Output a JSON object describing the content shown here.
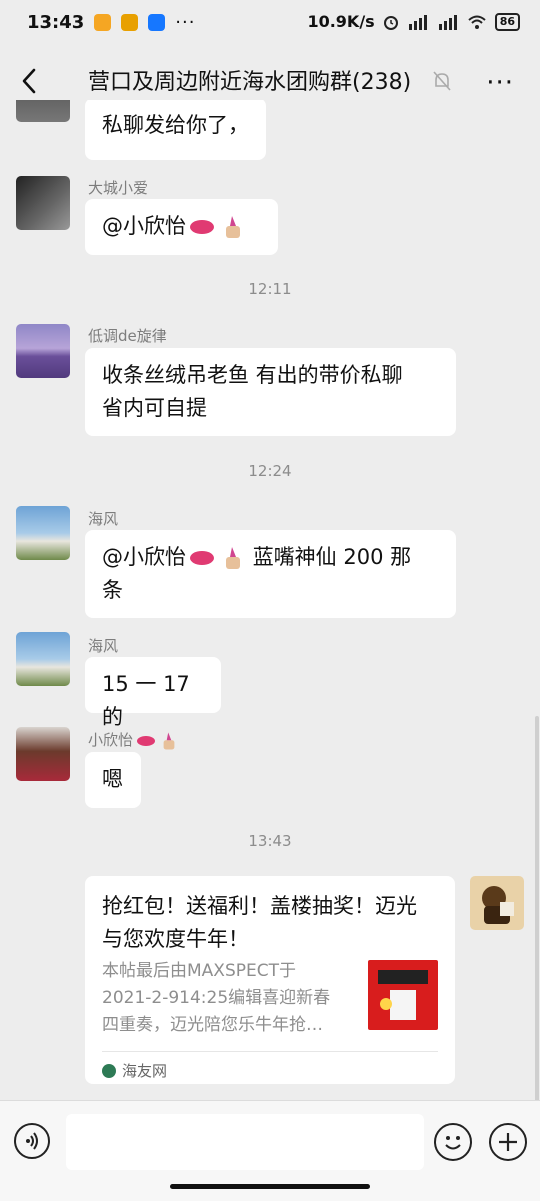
{
  "status_bar": {
    "time": "13:43",
    "speed": "10.9K/s",
    "battery": "86",
    "overflow": "···"
  },
  "header": {
    "title": "营口及周边附近海水团购群(238)",
    "more": "···"
  },
  "messages": [
    {
      "sender": "",
      "text": "私聊发给你了，"
    },
    {
      "sender": "大城小爱",
      "text": "@小欣怡"
    },
    {
      "time": "12:11"
    },
    {
      "sender": "低调de旋律",
      "line1": "收条丝绒吊老鱼  有出的带价私聊",
      "line2": "省内可自提"
    },
    {
      "time": "12:24"
    },
    {
      "sender": "海风",
      "prefix": "@小欣怡",
      "suffix": "蓝嘴神仙 200 那",
      "line2": "条"
    },
    {
      "sender": "海风",
      "text": "15 一 17 的"
    },
    {
      "sender": "小欣怡",
      "text": "嗯"
    },
    {
      "time": "13:43"
    }
  ],
  "card": {
    "title_line1": "抢红包！送福利！盖楼抽奖！迈光",
    "title_line2": "与您欢度牛年！",
    "desc_line1": "本帖最后由MAXSPECT于",
    "desc_line2": "2021-2-914:25编辑喜迎新春",
    "desc_line3": "四重奏，迈光陪您乐牛年抢…",
    "source": "海友网"
  },
  "colors": {
    "background": "#ededed",
    "bubble": "#ffffff",
    "thumb": "#d81d1d"
  }
}
